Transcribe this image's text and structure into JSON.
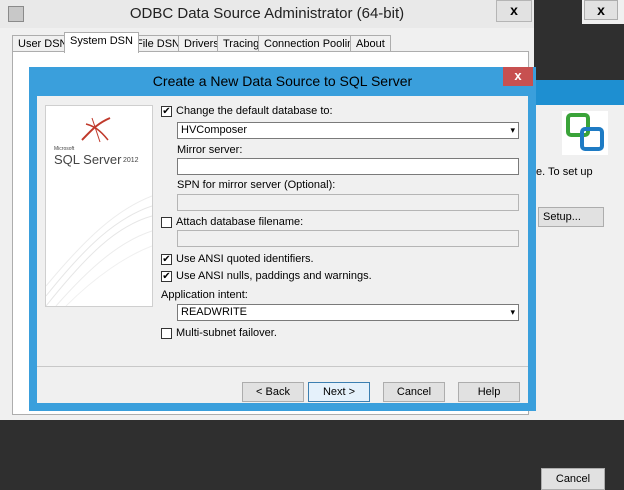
{
  "odbc": {
    "title": "ODBC Data Source Administrator (64-bit)",
    "close_glyph": "x",
    "tabs": [
      "User DSN",
      "System DSN",
      "File DSN",
      "Drivers",
      "Tracing",
      "Connection Pooling",
      "About"
    ],
    "active_tab": "System DSN"
  },
  "right_window": {
    "text": "e. To set up",
    "setup_label": "Setup...",
    "cancel_label": "Cancel",
    "close_glyph": "x"
  },
  "dialog": {
    "title": "Create a New Data Source to SQL Server",
    "close_glyph": "x",
    "logo": {
      "microsoft": "Microsoft",
      "product": "SQL Server",
      "version": "2012"
    },
    "change_default_db": {
      "label": "Change the default database to:",
      "checked": true,
      "value": "HVComposer"
    },
    "mirror_server": {
      "label": "Mirror server:",
      "value": ""
    },
    "spn": {
      "label": "SPN for mirror server (Optional):",
      "value": ""
    },
    "attach_db": {
      "label": "Attach database filename:",
      "checked": false,
      "value": ""
    },
    "ansi_quoted": {
      "label": "Use ANSI quoted identifiers.",
      "checked": true
    },
    "ansi_nulls": {
      "label": "Use ANSI nulls, paddings and warnings.",
      "checked": true
    },
    "app_intent": {
      "label": "Application intent:",
      "value": "READWRITE"
    },
    "multi_subnet": {
      "label": "Multi-subnet failover.",
      "checked": false
    },
    "buttons": {
      "back": "< Back",
      "next": "Next >",
      "cancel": "Cancel",
      "help": "Help"
    },
    "check_glyph": "✔",
    "dropdown_glyph": "▾"
  }
}
